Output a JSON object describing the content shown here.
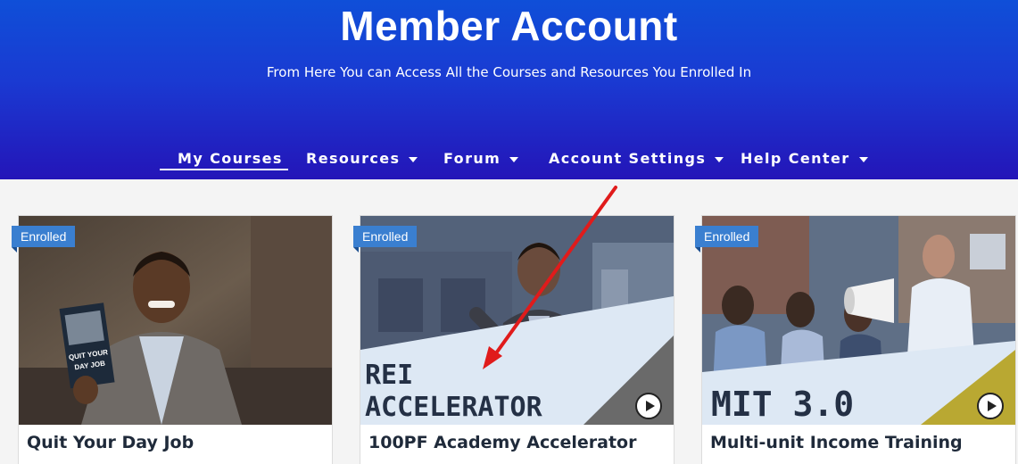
{
  "header": {
    "title": "Member Account",
    "subtitle": "From Here You can Access All the Courses and Resources You Enrolled In"
  },
  "nav": {
    "items": [
      {
        "label": "My Courses",
        "active": true,
        "dropdown": false
      },
      {
        "label": "Resources",
        "dropdown": true
      },
      {
        "label": "Forum",
        "dropdown": true
      },
      {
        "label": "Account Settings",
        "dropdown": true
      },
      {
        "label": "Help Center",
        "dropdown": true
      }
    ]
  },
  "courses": [
    {
      "title": "Quit Your Day Job",
      "badge": "Enrolled",
      "book_text": "QUIT YOUR DAY JOB"
    },
    {
      "title": "100PF Academy Accelerator",
      "badge": "Enrolled",
      "overlay_line1": "REI",
      "overlay_line2": "ACCELERATOR",
      "overlay_color": "#6a6a6a"
    },
    {
      "title": "Multi-unit Income Training",
      "badge": "Enrolled",
      "overlay_line1": "MIT 3.0",
      "overlay_color": "#b9a832"
    }
  ],
  "colors": {
    "header_top": "#0f4fd8",
    "header_bottom": "#2415b8",
    "badge": "#3a7fd0",
    "arrow": "#e01b1b"
  }
}
